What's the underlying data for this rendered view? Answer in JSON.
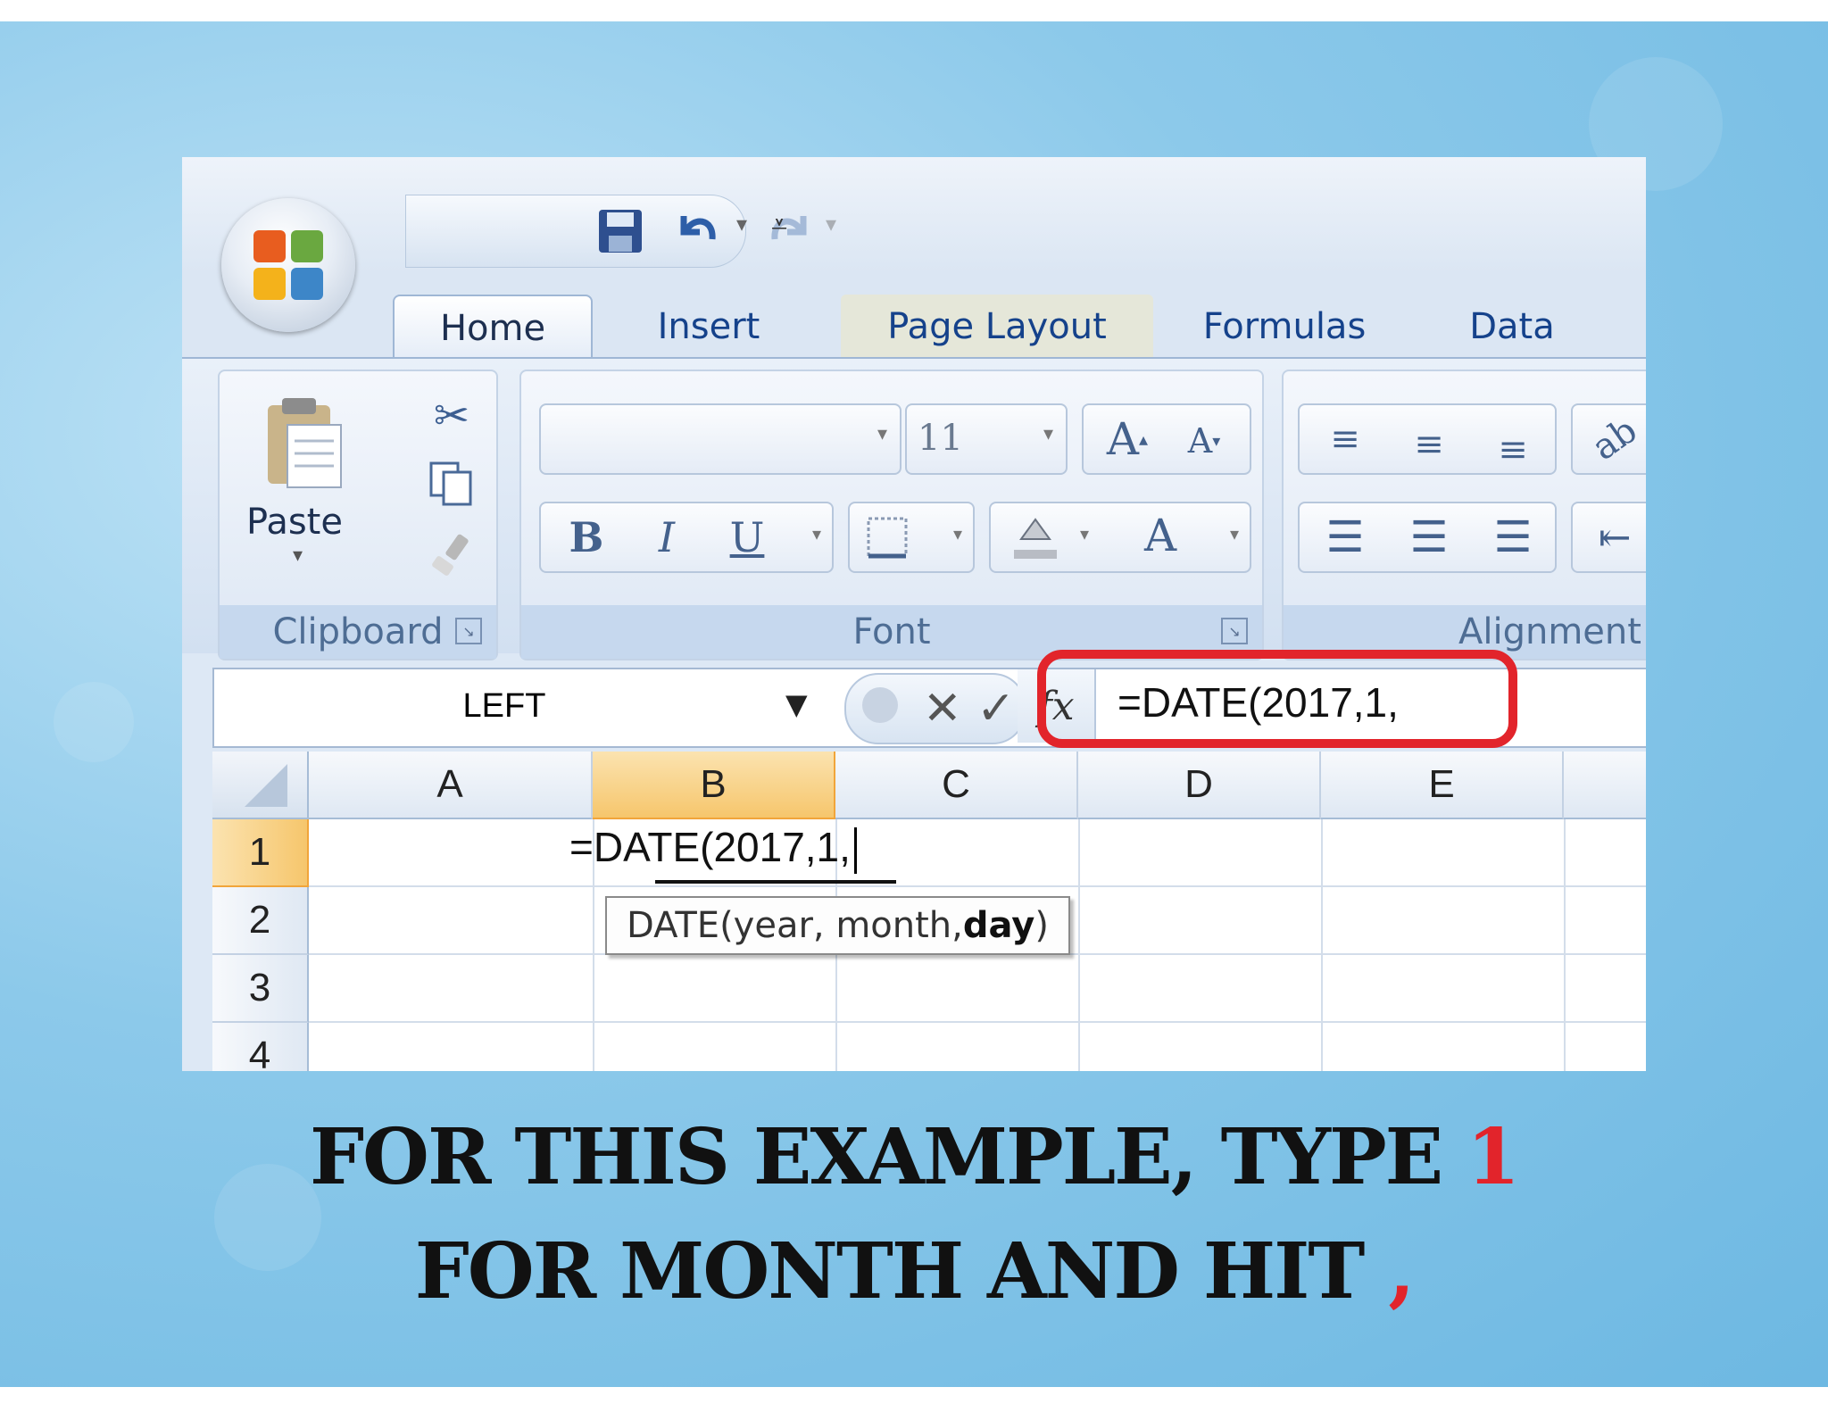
{
  "qat": {
    "save_icon": "save-icon",
    "undo_icon": "undo-icon",
    "redo_icon": "redo-icon",
    "customize_icon": "customize-qat-icon"
  },
  "tabs": [
    {
      "label": "Home",
      "active": true
    },
    {
      "label": "Insert"
    },
    {
      "label": "Page Layout"
    },
    {
      "label": "Formulas"
    },
    {
      "label": "Data"
    }
  ],
  "ribbon": {
    "clipboard": {
      "label": "Clipboard",
      "paste_label": "Paste"
    },
    "font": {
      "label": "Font",
      "size_value": "11"
    },
    "alignment": {
      "label": "Alignment"
    }
  },
  "formula_bar": {
    "name_box": "LEFT",
    "content": "=DATE(2017,1,"
  },
  "grid": {
    "columns": [
      "A",
      "B",
      "C",
      "D",
      "E"
    ],
    "rows": [
      "1",
      "2",
      "3",
      "4"
    ],
    "active_cell_text": "=DATE(2017,1,",
    "tooltip": {
      "prefix": "DATE(year, month, ",
      "bold": "day",
      "suffix": ")"
    }
  },
  "caption": {
    "line1_text": "FOR THIS EXAMPLE, TYPE ",
    "line1_highlight": "1",
    "line2_text": "FOR MONTH AND HIT ",
    "line2_highlight": ","
  },
  "colors": {
    "highlight_red": "#e2242b",
    "ribbon_text": "#15428b",
    "selected_header": "#f6c66c"
  }
}
